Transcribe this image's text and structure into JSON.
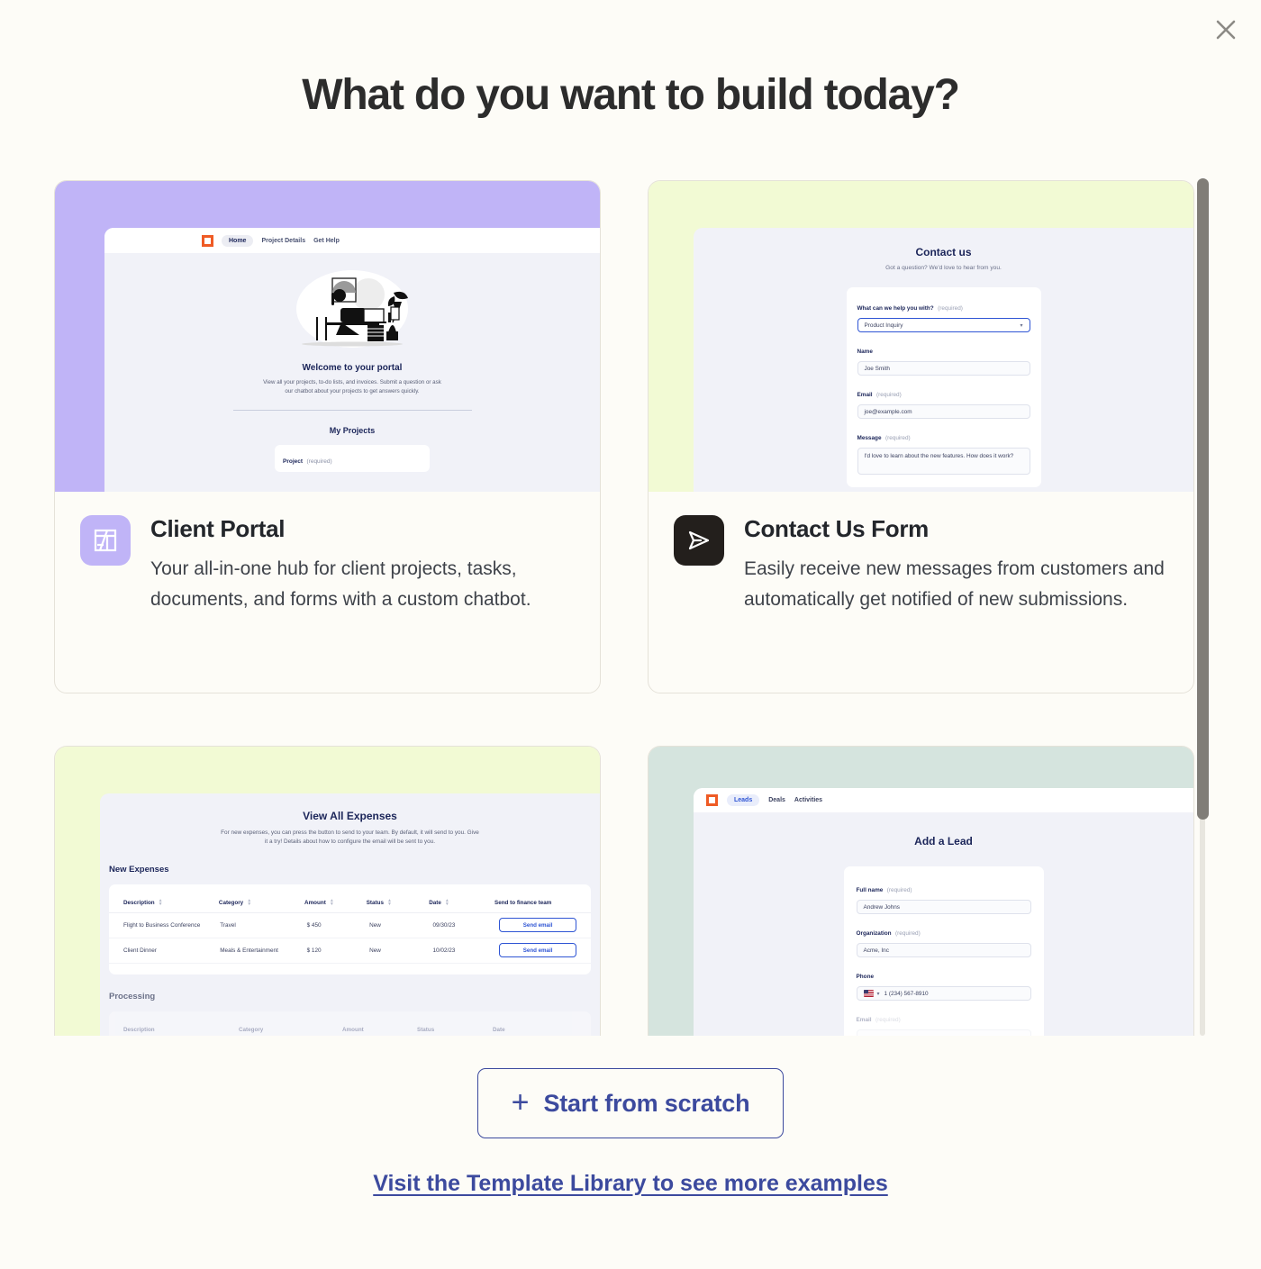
{
  "modal": {
    "title": "What do you want to build today?",
    "close_label": "Close",
    "close_icon": "close-icon"
  },
  "templates": [
    {
      "id": "client-portal",
      "title": "Client Portal",
      "description": "Your all-in-one hub for client projects, tasks, documents, and forms with a custom chatbot.",
      "icon": "layout-grid-icon",
      "icon_bg": "#c0b4f7",
      "preview_bg": "#c0b4f7",
      "preview": {
        "nav": [
          "Home",
          "Project Details",
          "Get Help"
        ],
        "nav_active": "Home",
        "heading": "Welcome to your portal",
        "subheading": "View all your projects, to-do lists, and invoices. Submit a question or ask our chatbot about your projects to get answers quickly.",
        "section_title": "My Projects",
        "field_label": "Project",
        "field_required": "(required)"
      }
    },
    {
      "id": "contact-us-form",
      "title": "Contact Us Form",
      "description": "Easily receive new messages from customers and automatically get notified of new submissions.",
      "icon": "paper-plane-icon",
      "icon_bg": "#231f1c",
      "preview_bg": "#f2fad4",
      "preview": {
        "heading": "Contact us",
        "subheading": "Got a question? We'd love to hear from you.",
        "fields": [
          {
            "label": "What can we help you with?",
            "required": "(required)",
            "value": "Product Inquiry",
            "type": "select"
          },
          {
            "label": "Name",
            "required": "",
            "value": "Joe Smith",
            "type": "text"
          },
          {
            "label": "Email",
            "required": "(required)",
            "value": "joe@example.com",
            "type": "text"
          },
          {
            "label": "Message",
            "required": "(required)",
            "value": "I'd love to learn about the new features. How does it work?",
            "type": "textarea"
          }
        ]
      }
    },
    {
      "id": "expenses",
      "title": "",
      "description": "",
      "icon": "",
      "icon_bg": "",
      "preview_bg": "#f2fad4",
      "preview": {
        "heading": "View All Expenses",
        "subheading": "For new expenses, you can press the button to send to your team. By default, it will send to you. Give it a try! Details about how to configure the email will be sent to you.",
        "section_title": "New Expenses",
        "section_title_2": "Processing",
        "columns": [
          "Description",
          "Category",
          "Amount",
          "Status",
          "Date",
          "Send to finance team"
        ],
        "rows": [
          [
            "Flight to Business Conference",
            "Travel",
            "$ 450",
            "New",
            "09/30/23",
            "Send email"
          ],
          [
            "Client Dinner",
            "Meals & Entertainment",
            "$ 120",
            "New",
            "10/02/23",
            "Send email"
          ]
        ]
      }
    },
    {
      "id": "crm-leads",
      "title": "",
      "description": "",
      "icon": "",
      "icon_bg": "",
      "preview_bg": "#d5e4de",
      "preview": {
        "nav": [
          "Leads",
          "Deals",
          "Activities"
        ],
        "nav_active": "Leads",
        "heading": "Add a Lead",
        "fields": [
          {
            "label": "Full name",
            "required": "(required)",
            "value": "Andrew Johns",
            "type": "text"
          },
          {
            "label": "Organization",
            "required": "(required)",
            "value": "Acme, Inc",
            "type": "text"
          },
          {
            "label": "Phone",
            "required": "",
            "value": "1 (234) 567-8910",
            "type": "phone"
          },
          {
            "label": "Email",
            "required": "(required)",
            "value": "",
            "type": "text"
          }
        ]
      }
    }
  ],
  "footer": {
    "scratch_label": "Start from scratch",
    "scratch_icon": "plus-icon",
    "library_link": "Visit the Template Library to see more examples"
  },
  "colors": {
    "accent_blue": "#3c4a9e",
    "brand_orange": "#ef5b25",
    "page_bg": "#fdfcf7"
  }
}
